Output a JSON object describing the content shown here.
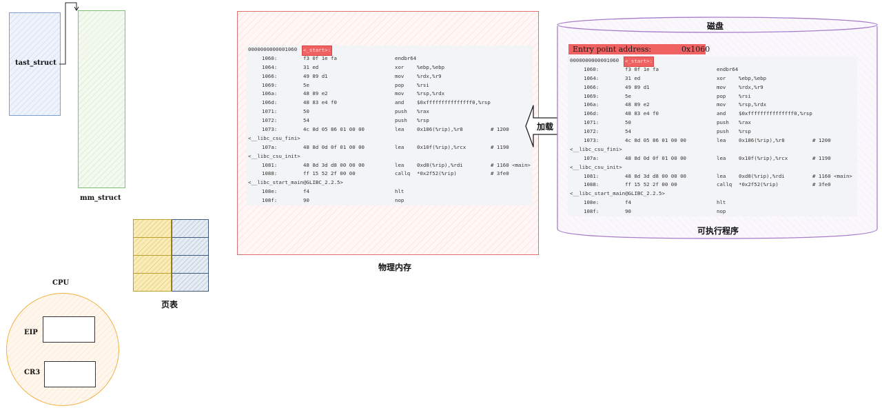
{
  "labels": {
    "task_struct": "tast_struct",
    "mm_struct": "mm_struct",
    "page_table": "页表",
    "cpu": "CPU",
    "eip": "EIP",
    "cr3": "CR3",
    "physical_memory": "物理内存",
    "disk": "磁盘",
    "executable": "可执行程序",
    "load_arrow": "加载"
  },
  "entry_point": {
    "label": "Entry point address:",
    "value": "0x1060"
  },
  "disassembly": {
    "header_addr": "0000000000001060",
    "header_sym": "<_start>:",
    "lines": [
      {
        "addr": "1060:",
        "bytes": "f3 0f 1e fa",
        "op": "endbr64",
        "args": "",
        "comment": ""
      },
      {
        "addr": "1064:",
        "bytes": "31 ed",
        "op": "xor",
        "args": "%ebp,%ebp",
        "comment": ""
      },
      {
        "addr": "1066:",
        "bytes": "49 89 d1",
        "op": "mov",
        "args": "%rdx,%r9",
        "comment": ""
      },
      {
        "addr": "1069:",
        "bytes": "5e",
        "op": "pop",
        "args": "%rsi",
        "comment": ""
      },
      {
        "addr": "106a:",
        "bytes": "48 89 e2",
        "op": "mov",
        "args": "%rsp,%rdx",
        "comment": ""
      },
      {
        "addr": "106d:",
        "bytes": "48 83 e4 f0",
        "op": "and",
        "args": "$0xfffffffffffffff0,%rsp",
        "comment": ""
      },
      {
        "addr": "1071:",
        "bytes": "50",
        "op": "push",
        "args": "%rax",
        "comment": ""
      },
      {
        "addr": "1072:",
        "bytes": "54",
        "op": "push",
        "args": "%rsp",
        "comment": ""
      },
      {
        "addr": "1073:",
        "bytes": "4c 8d 05 86 01 00 00",
        "op": "lea",
        "args": "0x186(%rip),%r8",
        "comment": "# 1200"
      },
      {
        "cont": "<__libc_csu_fini>"
      },
      {
        "addr": "107a:",
        "bytes": "48 8d 0d 0f 01 00 00",
        "op": "lea",
        "args": "0x10f(%rip),%rcx",
        "comment": "# 1190"
      },
      {
        "cont": "<__libc_csu_init>"
      },
      {
        "addr": "1081:",
        "bytes": "48 8d 3d d8 00 00 00",
        "op": "lea",
        "args": "0xd8(%rip),%rdi",
        "comment": "# 1160 <main>"
      },
      {
        "addr": "1088:",
        "bytes": "ff 15 52 2f 00 00",
        "op": "callq",
        "args": "*0x2f52(%rip)",
        "comment": "# 3fe0"
      },
      {
        "cont": "<__libc_start_main@GLIBC_2.2.5>"
      },
      {
        "addr": "108e:",
        "bytes": "f4",
        "op": "hlt",
        "args": "",
        "comment": ""
      },
      {
        "addr": "108f:",
        "bytes": "90",
        "op": "nop",
        "args": "",
        "comment": ""
      }
    ]
  },
  "colors": {
    "highlight": "#f06262",
    "task_struct_stroke": "#7a9cd0",
    "mm_struct_stroke": "#78c36a",
    "memory_stroke": "#e07070",
    "disk_stroke": "#a77cc9",
    "cpu_stroke": "#f0b040"
  }
}
